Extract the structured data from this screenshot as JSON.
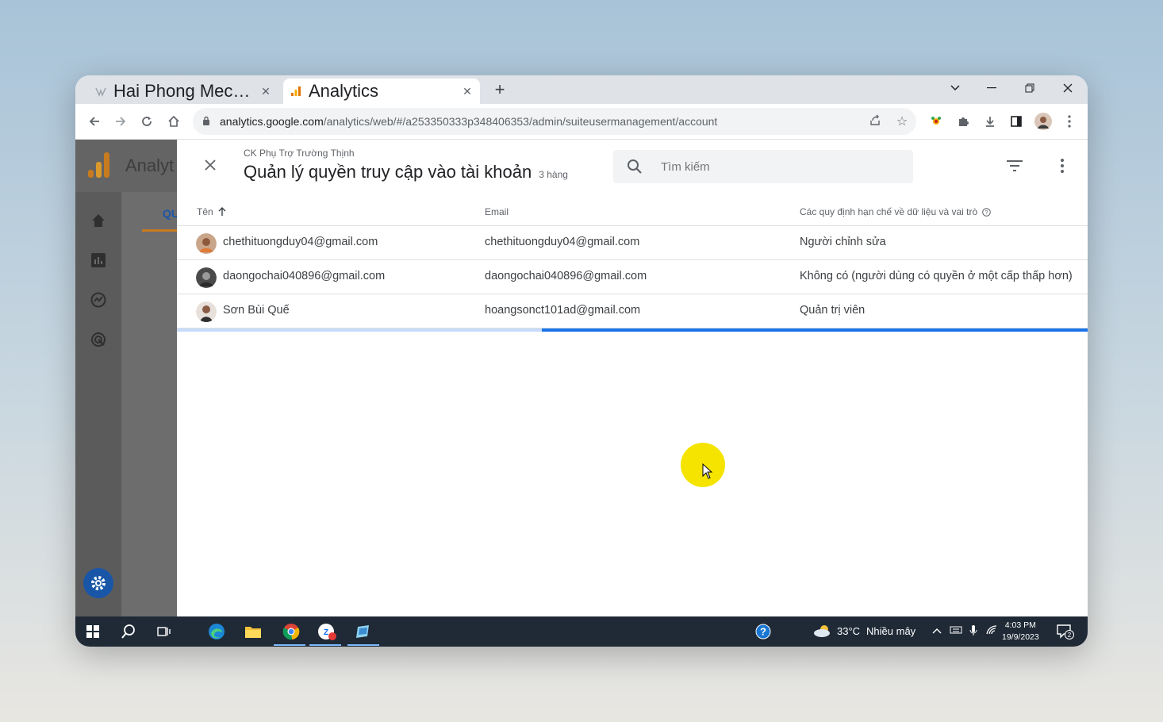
{
  "browser": {
    "tabs": [
      {
        "title": "Hai Phong Mechanic, Hai Phong M"
      },
      {
        "title": "Analytics"
      }
    ],
    "url_host": "analytics.google.com",
    "url_path": "/analytics/web/#/a253350333p348406353/admin/suiteusermanagement/account"
  },
  "app": {
    "brand": "Analyt",
    "bg_tab_label": "QU",
    "accent": "#1a56a8"
  },
  "panel": {
    "subtitle": "CK Phụ Trợ Trường Thịnh",
    "title": "Quản lý quyền truy cập vào tài khoản",
    "row_count": "3 hàng",
    "search_placeholder": "Tìm kiếm",
    "columns": {
      "name": "Tên",
      "email": "Email",
      "role": "Các quy định hạn chế về dữ liệu và vai trò"
    },
    "rows": [
      {
        "name": "chethituongduy04@gmail.com",
        "email": "chethituongduy04@gmail.com",
        "role": "Người chỉnh sửa"
      },
      {
        "name": "daongochai040896@gmail.com",
        "email": "daongochai040896@gmail.com",
        "role": "Không có (người dùng có quyền ở một cấp thấp hơn)"
      },
      {
        "name": "Sơn Bùi Quế",
        "email": "hoangsonct101ad@gmail.com",
        "role": "Quản trị viên"
      }
    ]
  },
  "taskbar": {
    "temperature": "33°C",
    "weather": "Nhiều mây",
    "time": "4:03 PM",
    "date": "19/9/2023",
    "notif_count": "2"
  }
}
